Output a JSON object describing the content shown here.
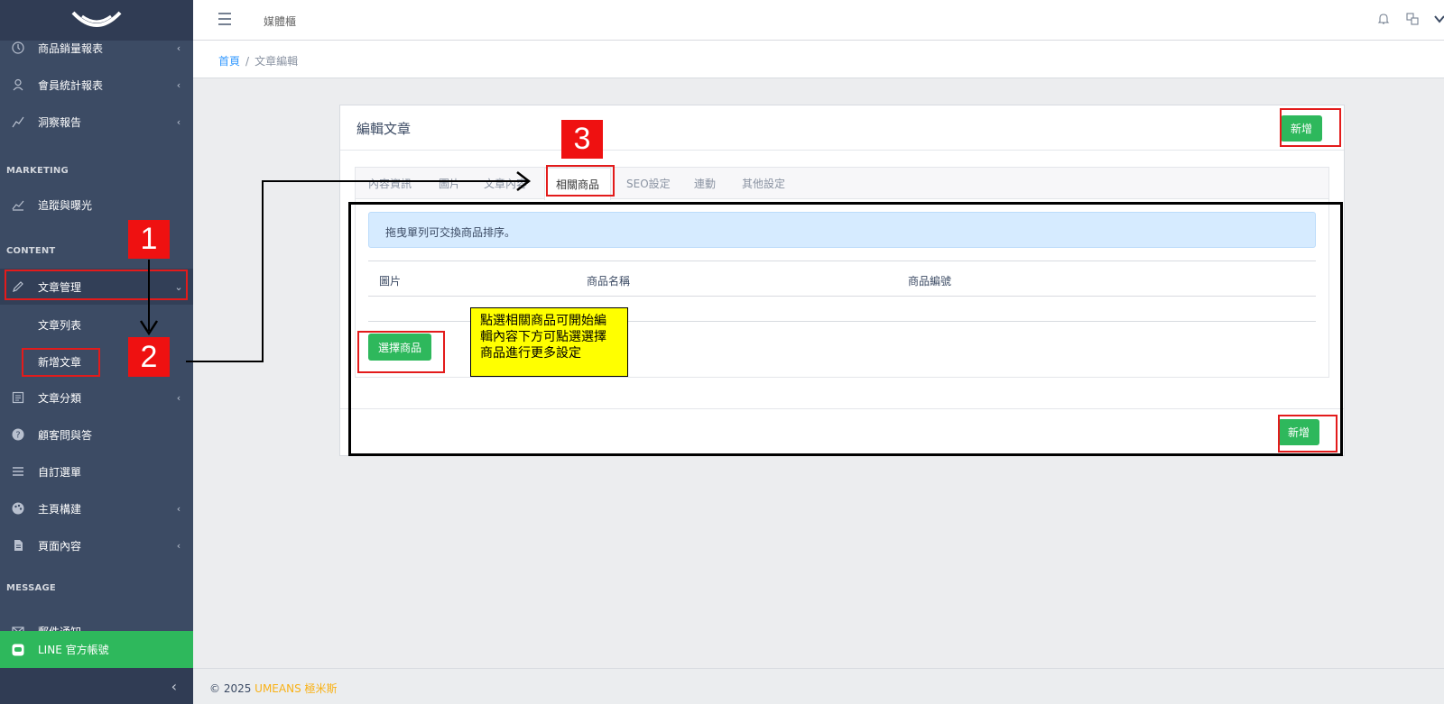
{
  "sidebar": {
    "items_top": [
      {
        "label": "商品銷量報表",
        "icon": "clock-icon"
      },
      {
        "label": "會員統計報表",
        "icon": "user-icon"
      },
      {
        "label": "洞察報告",
        "icon": "chart-line-icon"
      }
    ],
    "heading_marketing": "MARKETING",
    "item_tracking": "追蹤與曝光",
    "heading_content": "CONTENT",
    "item_article_mgmt": "文章管理",
    "sub_article_list": "文章列表",
    "sub_add_article": "新增文章",
    "items_bottom": [
      {
        "label": "文章分類"
      },
      {
        "label": "顧客問與答"
      },
      {
        "label": "自訂選單"
      },
      {
        "label": "主頁構建"
      },
      {
        "label": "頁面內容"
      }
    ],
    "heading_message": "MESSAGE",
    "item_mail": "郵件通知",
    "line_label": "LINE 官方帳號"
  },
  "header": {
    "title": "媒體櫃"
  },
  "breadcrumb": {
    "home": "首頁",
    "current": "文章編輯"
  },
  "card": {
    "title": "編輯文章",
    "add_button": "新增",
    "tabs": [
      "內容資訊",
      "圖片",
      "文章內容",
      "相關商品",
      "SEO設定",
      "連動",
      "其他設定"
    ],
    "alert": "拖曳單列可交換商品排序。",
    "columns": [
      "圖片",
      "商品名稱",
      "商品編號"
    ],
    "select_button": "選擇商品",
    "footer_add_button": "新增"
  },
  "annotations": {
    "num1": "1",
    "num2": "2",
    "num3": "3",
    "note_line1": "點選相關商品可開始編",
    "note_line2": "輯內容下方可點選選擇",
    "note_line3": "商品進行更多設定"
  },
  "footer": {
    "copyright": "© 2025 ",
    "brand": "UMEANS 極米斯"
  },
  "colors": {
    "sidebar": "#3c4b64",
    "green": "#2eb85c",
    "annotation_red": "#ef1111",
    "note_yellow": "#ffff00"
  }
}
